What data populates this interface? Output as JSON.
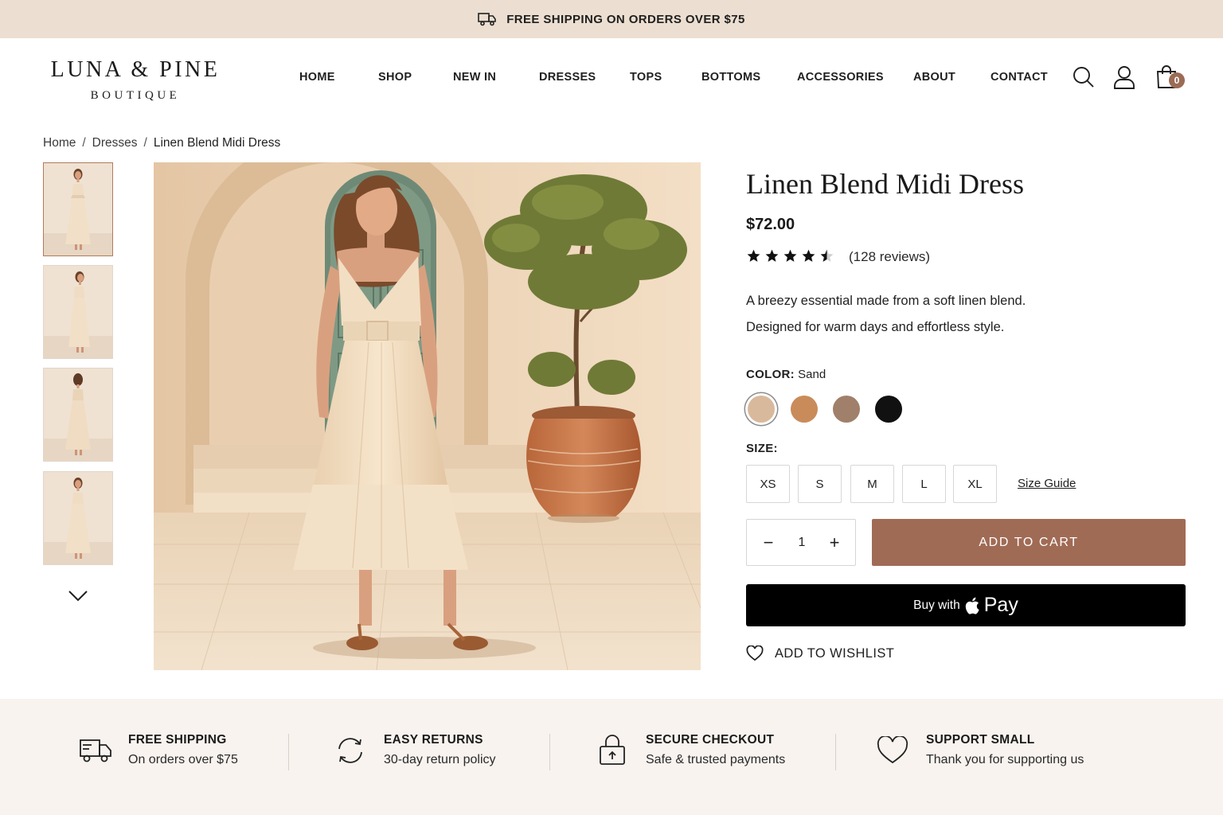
{
  "announcement": {
    "text": "FREE SHIPPING ON ORDERS OVER $75",
    "icon": "truck-icon"
  },
  "brand": {
    "name": "LUNA & PINE",
    "tagline": "BOUTIQUE"
  },
  "nav": [
    "HOME",
    "SHOP",
    "NEW IN",
    "DRESSES",
    "TOPS",
    "BOTTOMS",
    "ACCESSORIES",
    "ABOUT",
    "CONTACT"
  ],
  "header_icons": [
    "search-icon",
    "account-icon",
    "shopping-bag-icon"
  ],
  "cart": {
    "count": "0"
  },
  "breadcrumb": {
    "home": "Home",
    "sep": "/",
    "category": "Dresses",
    "current": "Linen Blend Midi Dress"
  },
  "product": {
    "title": "Linen Blend Midi Dress",
    "price": "$72.00",
    "rating": 4.5,
    "reviews": "(128 reviews)",
    "description": [
      "A breezy essential made from a soft linen blend.",
      "Designed for warm days and effortless style."
    ]
  },
  "color": {
    "label": "COLOR:",
    "selected": "Sand",
    "swatches": [
      {
        "name": "Sand",
        "hex": "#d9b99c"
      },
      {
        "name": "Caramel",
        "hex": "#c98b5a"
      },
      {
        "name": "Mocha",
        "hex": "#a0806a"
      },
      {
        "name": "Black",
        "hex": "#111111"
      }
    ]
  },
  "size": {
    "label": "SIZE:",
    "options": [
      "XS",
      "S",
      "M",
      "L",
      "XL"
    ],
    "guide": "Size Guide"
  },
  "quantity": {
    "minus": "−",
    "value": "1",
    "plus": "+"
  },
  "buttons": {
    "add_to_cart": "ADD TO CART",
    "apple_pay_prefix": "Buy with",
    "apple_pay": "Pay",
    "wishlist": "ADD TO WISHLIST"
  },
  "features": [
    {
      "icon": "truck-icon",
      "title": "FREE SHIPPING",
      "subtitle": "On orders over $75"
    },
    {
      "icon": "returns-icon",
      "title": "EASY RETURNS",
      "subtitle": "30-day return policy"
    },
    {
      "icon": "lock-icon",
      "title": "SECURE CHECKOUT",
      "subtitle": "Safe & trusted payments"
    },
    {
      "icon": "heart-icon",
      "title": "SUPPORT SMALL",
      "subtitle": "Thank you for supporting us"
    }
  ],
  "colors": {
    "accent": "#a06b55",
    "announcement_bg": "#ecdfd1",
    "features_bg": "#f8f3ef"
  }
}
